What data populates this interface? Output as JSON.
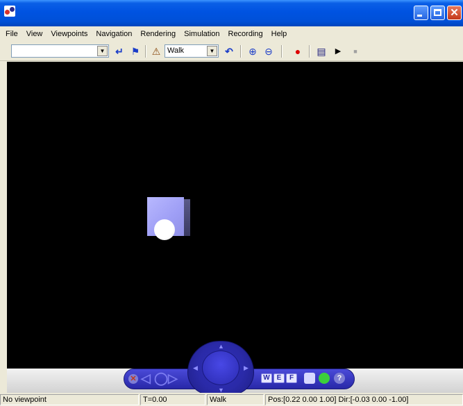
{
  "window": {
    "title": "",
    "controls": {
      "minimize": "minimize",
      "maximize": "maximize",
      "close": "✕"
    }
  },
  "menu": [
    "File",
    "View",
    "Viewpoints",
    "Navigation",
    "Rendering",
    "Simulation",
    "Recording",
    "Help"
  ],
  "toolbar": {
    "viewpoint_combo_value": "",
    "combo_arrow": "▼",
    "navigation_mode": "Walk",
    "icons": {
      "go_back": "↵",
      "flag": "⚑",
      "navigate_mode": "⚠",
      "undo_move": "↶",
      "zoom_in": "⊕",
      "zoom_out": "⊖",
      "record": "●",
      "console": "▤",
      "play": "▶",
      "stop": "■"
    }
  },
  "nav_panel": {
    "close": "✕",
    "left_arrow": "◁",
    "center_ring": "◯",
    "right_arrow": "▷",
    "buttons": [
      "W",
      "E",
      "F"
    ],
    "extra_icons": [
      "copy",
      "light",
      "help"
    ],
    "help": "?",
    "dial_arrows": {
      "up": "▲",
      "down": "▼",
      "left": "◀",
      "right": "▶"
    }
  },
  "status": {
    "viewpoint": "No viewpoint",
    "time": "T=0.00",
    "mode": "Walk",
    "position": "Pos:[0.22 0.00 1.00] Dir:[-0.03 0.00 -1.00]"
  },
  "colors": {
    "titlebar": "#0050d8",
    "viewport_bg": "#000000",
    "cube_front": "#a0a0f5",
    "cube_side": "#4a4a78",
    "sphere": "#ffffff",
    "nav_panel": "#2a2aa8",
    "record_red": "#dd0000",
    "flag_blue": "#1a3cc8"
  }
}
